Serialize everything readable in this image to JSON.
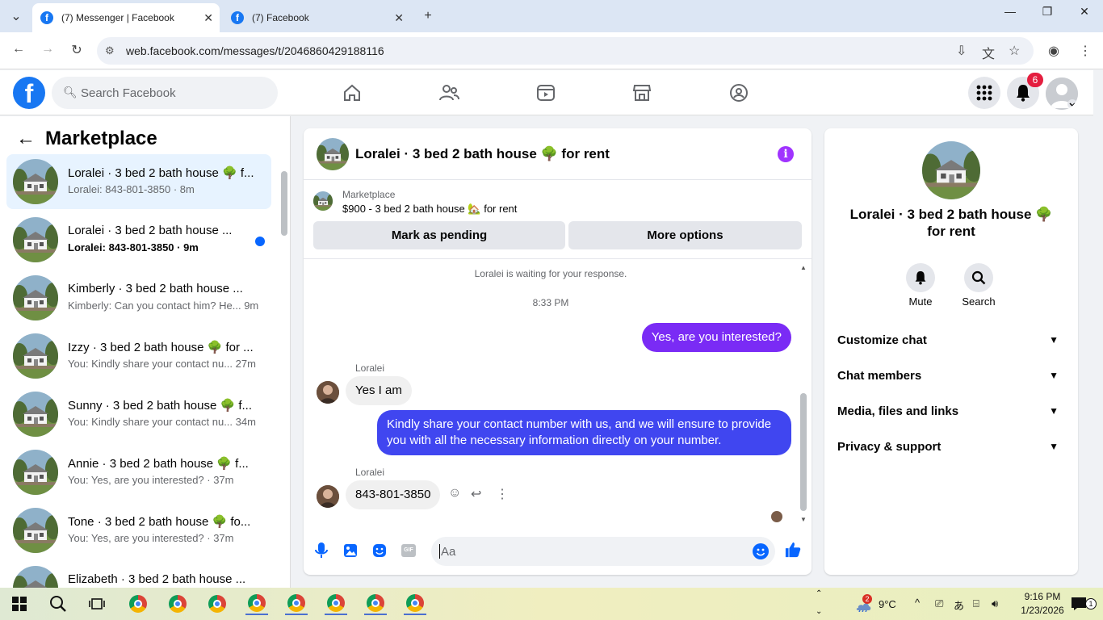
{
  "browser": {
    "tabs": [
      {
        "title": "(7) Messenger | Facebook",
        "active": true
      },
      {
        "title": "(7) Facebook",
        "active": false
      }
    ],
    "url": "web.facebook.com/messages/t/2046860429188116"
  },
  "fb": {
    "logo": "f",
    "search_placeholder": "Search Facebook",
    "notification_count": "6"
  },
  "left": {
    "title": "Marketplace",
    "conversations": [
      {
        "name": "Loralei · 3 bed 2 bath house 🌳 f...",
        "snippet": "Loralei: 843-801-3850 · 8m",
        "active": true,
        "unread": false
      },
      {
        "name": "Loralei · 3 bed 2 bath house ...",
        "snippet": "Loralei: 843-801-3850 · 9m",
        "active": false,
        "unread": true
      },
      {
        "name": "Kimberly · 3 bed 2 bath house ...",
        "snippet": "Kimberly: Can you contact him? He... 9m",
        "active": false,
        "unread": false
      },
      {
        "name": "Izzy · 3 bed 2 bath house 🌳 for ...",
        "snippet": "You: Kindly share your contact nu... 27m",
        "active": false,
        "unread": false
      },
      {
        "name": "Sunny · 3 bed 2 bath house 🌳 f...",
        "snippet": "You: Kindly share your contact nu... 34m",
        "active": false,
        "unread": false
      },
      {
        "name": "Annie · 3 bed 2 bath house 🌳 f...",
        "snippet": "You: Yes, are you interested? · 37m",
        "active": false,
        "unread": false
      },
      {
        "name": "Tone · 3 bed 2 bath house 🌳 fo...",
        "snippet": "You: Yes, are you interested? · 37m",
        "active": false,
        "unread": false
      },
      {
        "name": "Elizabeth · 3 bed 2 bath house ...",
        "snippet": "",
        "active": false,
        "unread": false
      }
    ]
  },
  "chat": {
    "title": "Loralei · 3 bed 2 bath house 🌳 for rent",
    "marketplace_label": "Marketplace",
    "listing": "$900 - 3 bed 2 bath house 🏡 for rent",
    "mark_pending": "Mark as pending",
    "more_options": "More options",
    "waiting": "Loralei is waiting for your response.",
    "time": "8:33 PM",
    "msg1": "Yes, are you interested?",
    "sender": "Loralei",
    "msg2": "Yes I am",
    "msg3_line1": "Kindly share your contact number with us, and we will ensure to provide",
    "msg3_line2": "you with all the necessary information directly on your number.",
    "msg4": "843-801-3850",
    "composer_placeholder": "Aa",
    "gif": "GIF"
  },
  "right": {
    "name_line1": "Loralei · 3 bed 2 bath house 🌳",
    "name_line2": "for rent",
    "mute": "Mute",
    "search": "Search",
    "sections": [
      "Customize chat",
      "Chat members",
      "Media, files and links",
      "Privacy & support"
    ]
  },
  "taskbar": {
    "weather_temp": "9°C",
    "weather_badge": "2",
    "time": "9:16 PM",
    "date": "1/23/2026",
    "notif": "1"
  }
}
